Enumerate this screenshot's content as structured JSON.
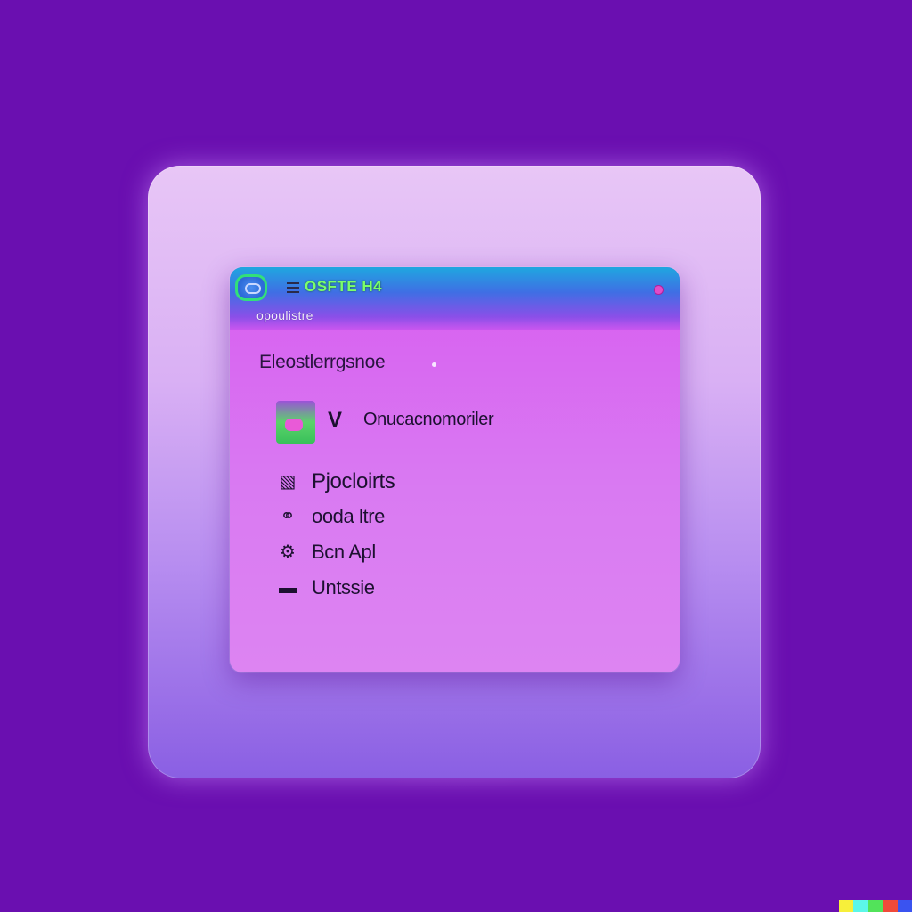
{
  "window": {
    "title": "OSFTE H4",
    "subtitle": "opoulistre"
  },
  "main": {
    "heading": "Eleostlerrgsnoe",
    "account": {
      "prefix_icon": "v-icon",
      "label": "Onucacnomoriler"
    },
    "items": [
      {
        "icon": "document-icon",
        "label": "Pjocloirts"
      },
      {
        "icon": "planet-icon",
        "label": "ooda ltre"
      },
      {
        "icon": "settings-icon",
        "label": "Bcn Apl"
      },
      {
        "icon": "folder-icon",
        "label": "Untssie"
      }
    ]
  },
  "colors": {
    "background": "#6a0fb0",
    "window_body": "#d97af2",
    "titlebar_start": "#1fa7e0",
    "title_text": "#7bff6a",
    "close_dot": "#e24cc8"
  }
}
